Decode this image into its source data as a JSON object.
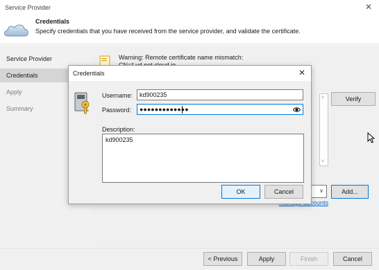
{
  "window": {
    "title": "Service Provider",
    "close_glyph": "✕"
  },
  "header": {
    "title": "Credentials",
    "subtitle": "Specify credentials that you have received from the service provider, and validate the certificate.",
    "icon": "cloud-icon"
  },
  "sidebar": {
    "items": [
      {
        "label": "Service Provider",
        "state": "normal"
      },
      {
        "label": "Credentials",
        "state": "selected"
      },
      {
        "label": "Apply",
        "state": "disabled"
      },
      {
        "label": "Summary",
        "state": "disabled"
      }
    ]
  },
  "content": {
    "warning_line1": "Warning: Remote certificate name mismatch:",
    "warning_line2": "CN=*.vd.net.cloud.io",
    "verify_label": "Verify",
    "add_label": "Add...",
    "manage_link": "Manage accounts",
    "scroll_up_glyph": "˄",
    "scroll_down_glyph": "˅",
    "combo_glyph": "∨"
  },
  "footer": {
    "previous_label": "< Previous",
    "apply_label": "Apply",
    "finish_label": "Finish",
    "cancel_label": "Cancel"
  },
  "dialog": {
    "title": "Credentials",
    "close_glyph": "✕",
    "username_label": "Username:",
    "username_value": "kd900235",
    "password_label": "Password:",
    "password_mask": "●●●●●●●●●●●●●",
    "description_label": "Description:",
    "description_value": "kd900235",
    "ok_label": "OK",
    "cancel_label": "Cancel"
  },
  "colors": {
    "accent": "#0078d7",
    "link": "#0066cc",
    "sidebar_selected": "#d5d5d5"
  }
}
